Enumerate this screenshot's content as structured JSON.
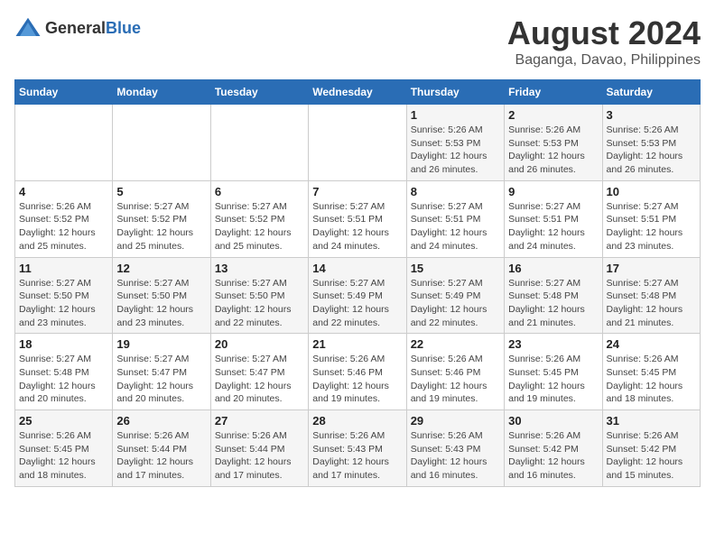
{
  "logo": {
    "general": "General",
    "blue": "Blue"
  },
  "title": "August 2024",
  "subtitle": "Baganga, Davao, Philippines",
  "headers": [
    "Sunday",
    "Monday",
    "Tuesday",
    "Wednesday",
    "Thursday",
    "Friday",
    "Saturday"
  ],
  "weeks": [
    [
      {
        "day": "",
        "detail": ""
      },
      {
        "day": "",
        "detail": ""
      },
      {
        "day": "",
        "detail": ""
      },
      {
        "day": "",
        "detail": ""
      },
      {
        "day": "1",
        "detail": "Sunrise: 5:26 AM\nSunset: 5:53 PM\nDaylight: 12 hours\nand 26 minutes."
      },
      {
        "day": "2",
        "detail": "Sunrise: 5:26 AM\nSunset: 5:53 PM\nDaylight: 12 hours\nand 26 minutes."
      },
      {
        "day": "3",
        "detail": "Sunrise: 5:26 AM\nSunset: 5:53 PM\nDaylight: 12 hours\nand 26 minutes."
      }
    ],
    [
      {
        "day": "4",
        "detail": "Sunrise: 5:26 AM\nSunset: 5:52 PM\nDaylight: 12 hours\nand 25 minutes."
      },
      {
        "day": "5",
        "detail": "Sunrise: 5:27 AM\nSunset: 5:52 PM\nDaylight: 12 hours\nand 25 minutes."
      },
      {
        "day": "6",
        "detail": "Sunrise: 5:27 AM\nSunset: 5:52 PM\nDaylight: 12 hours\nand 25 minutes."
      },
      {
        "day": "7",
        "detail": "Sunrise: 5:27 AM\nSunset: 5:51 PM\nDaylight: 12 hours\nand 24 minutes."
      },
      {
        "day": "8",
        "detail": "Sunrise: 5:27 AM\nSunset: 5:51 PM\nDaylight: 12 hours\nand 24 minutes."
      },
      {
        "day": "9",
        "detail": "Sunrise: 5:27 AM\nSunset: 5:51 PM\nDaylight: 12 hours\nand 24 minutes."
      },
      {
        "day": "10",
        "detail": "Sunrise: 5:27 AM\nSunset: 5:51 PM\nDaylight: 12 hours\nand 23 minutes."
      }
    ],
    [
      {
        "day": "11",
        "detail": "Sunrise: 5:27 AM\nSunset: 5:50 PM\nDaylight: 12 hours\nand 23 minutes."
      },
      {
        "day": "12",
        "detail": "Sunrise: 5:27 AM\nSunset: 5:50 PM\nDaylight: 12 hours\nand 23 minutes."
      },
      {
        "day": "13",
        "detail": "Sunrise: 5:27 AM\nSunset: 5:50 PM\nDaylight: 12 hours\nand 22 minutes."
      },
      {
        "day": "14",
        "detail": "Sunrise: 5:27 AM\nSunset: 5:49 PM\nDaylight: 12 hours\nand 22 minutes."
      },
      {
        "day": "15",
        "detail": "Sunrise: 5:27 AM\nSunset: 5:49 PM\nDaylight: 12 hours\nand 22 minutes."
      },
      {
        "day": "16",
        "detail": "Sunrise: 5:27 AM\nSunset: 5:48 PM\nDaylight: 12 hours\nand 21 minutes."
      },
      {
        "day": "17",
        "detail": "Sunrise: 5:27 AM\nSunset: 5:48 PM\nDaylight: 12 hours\nand 21 minutes."
      }
    ],
    [
      {
        "day": "18",
        "detail": "Sunrise: 5:27 AM\nSunset: 5:48 PM\nDaylight: 12 hours\nand 20 minutes."
      },
      {
        "day": "19",
        "detail": "Sunrise: 5:27 AM\nSunset: 5:47 PM\nDaylight: 12 hours\nand 20 minutes."
      },
      {
        "day": "20",
        "detail": "Sunrise: 5:27 AM\nSunset: 5:47 PM\nDaylight: 12 hours\nand 20 minutes."
      },
      {
        "day": "21",
        "detail": "Sunrise: 5:26 AM\nSunset: 5:46 PM\nDaylight: 12 hours\nand 19 minutes."
      },
      {
        "day": "22",
        "detail": "Sunrise: 5:26 AM\nSunset: 5:46 PM\nDaylight: 12 hours\nand 19 minutes."
      },
      {
        "day": "23",
        "detail": "Sunrise: 5:26 AM\nSunset: 5:45 PM\nDaylight: 12 hours\nand 19 minutes."
      },
      {
        "day": "24",
        "detail": "Sunrise: 5:26 AM\nSunset: 5:45 PM\nDaylight: 12 hours\nand 18 minutes."
      }
    ],
    [
      {
        "day": "25",
        "detail": "Sunrise: 5:26 AM\nSunset: 5:45 PM\nDaylight: 12 hours\nand 18 minutes."
      },
      {
        "day": "26",
        "detail": "Sunrise: 5:26 AM\nSunset: 5:44 PM\nDaylight: 12 hours\nand 17 minutes."
      },
      {
        "day": "27",
        "detail": "Sunrise: 5:26 AM\nSunset: 5:44 PM\nDaylight: 12 hours\nand 17 minutes."
      },
      {
        "day": "28",
        "detail": "Sunrise: 5:26 AM\nSunset: 5:43 PM\nDaylight: 12 hours\nand 17 minutes."
      },
      {
        "day": "29",
        "detail": "Sunrise: 5:26 AM\nSunset: 5:43 PM\nDaylight: 12 hours\nand 16 minutes."
      },
      {
        "day": "30",
        "detail": "Sunrise: 5:26 AM\nSunset: 5:42 PM\nDaylight: 12 hours\nand 16 minutes."
      },
      {
        "day": "31",
        "detail": "Sunrise: 5:26 AM\nSunset: 5:42 PM\nDaylight: 12 hours\nand 15 minutes."
      }
    ]
  ]
}
